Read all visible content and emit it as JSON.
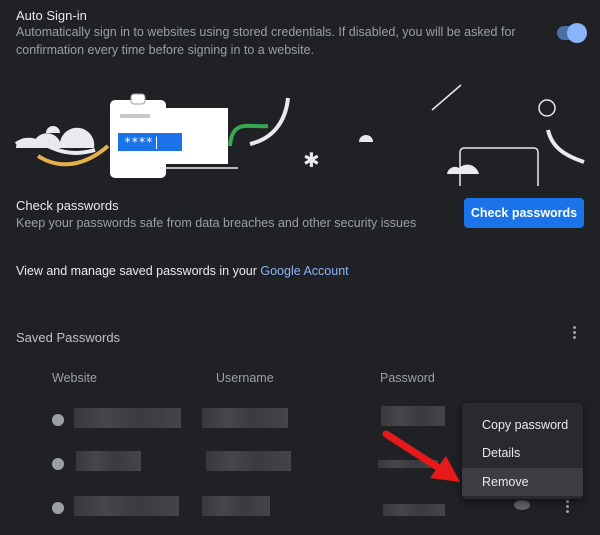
{
  "auto_signin": {
    "title": "Auto Sign-in",
    "description_line1": "Automatically sign in to websites using stored credentials. If disabled, you will be asked for",
    "description_line2": "confirmation every time before signing in to a website.",
    "enabled": true
  },
  "illustration": {
    "password_mask": "****|",
    "asterisk": "✱"
  },
  "check_passwords": {
    "title": "Check passwords",
    "description": "Keep your passwords safe from data breaches and other security issues",
    "button_label": "Check passwords"
  },
  "manage": {
    "text": "View and manage saved passwords in your ",
    "link": "Google Account"
  },
  "saved_passwords": {
    "title": "Saved Passwords",
    "columns": {
      "website": "Website",
      "username": "Username",
      "password": "Password"
    }
  },
  "context_menu": {
    "items": [
      "Copy password",
      "Details",
      "Remove"
    ],
    "highlighted": "Remove"
  },
  "colors": {
    "accent": "#1a73e8",
    "link": "#8ab4f8",
    "arrow": "#e8191b",
    "background": "#202124"
  }
}
